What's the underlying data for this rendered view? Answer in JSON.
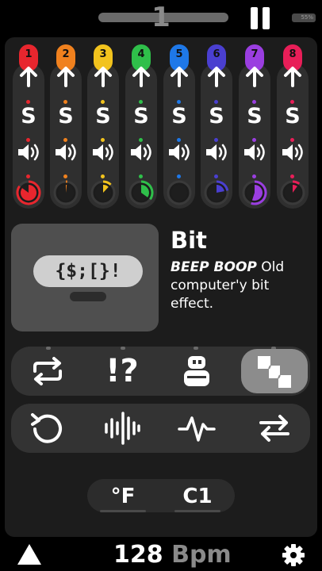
{
  "topbar": {
    "beat_number": "1",
    "battery_label": "55%"
  },
  "channels": [
    {
      "label": "1",
      "color": "#e8262e",
      "knob_fill": 0.85
    },
    {
      "label": "2",
      "color": "#f0811e",
      "knob_fill": 0.02
    },
    {
      "label": "3",
      "color": "#f2c31d",
      "knob_fill": 0.12
    },
    {
      "label": "4",
      "color": "#2fbf4a",
      "knob_fill": 0.35
    },
    {
      "label": "5",
      "color": "#1e78e8",
      "knob_fill": 0.0
    },
    {
      "label": "6",
      "color": "#4a3fd0",
      "knob_fill": 0.22
    },
    {
      "label": "7",
      "color": "#9a3ee0",
      "knob_fill": 0.55
    },
    {
      "label": "8",
      "color": "#e81e58",
      "knob_fill": 0.1
    }
  ],
  "effect": {
    "glyph": "{$;[}!",
    "title": "Bit",
    "desc_emph": "BEEP BOOP",
    "desc_rest": " Old computer'y bit effect."
  },
  "bottom": {
    "unit_label": "°F",
    "key_label": "C1",
    "bpm_value": "128",
    "bpm_unit": "Bpm"
  },
  "icons": {
    "row1": [
      "repeat-icon",
      "exclaim-question-icon",
      "robot-icon",
      "stairs-icon"
    ],
    "row2": [
      "restart-icon",
      "waveform-icon",
      "pulse-icon",
      "swap-icon"
    ]
  },
  "colors": {
    "background": "#000000",
    "panel": "#1c1c1c",
    "strip": "#2f2f2f",
    "active_button": "#8c8c8c"
  }
}
